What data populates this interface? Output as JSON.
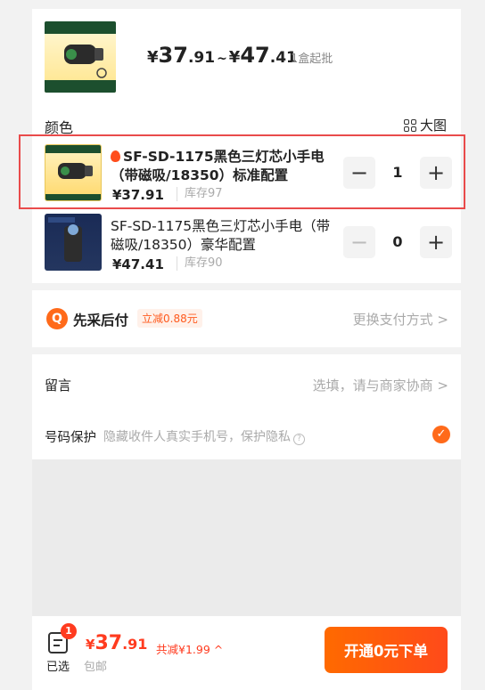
{
  "product": {
    "price_min_symbol": "¥",
    "price_min_int": "37",
    "price_min_dec": ".91",
    "price_sep": "~",
    "price_max_symbol": "¥",
    "price_max_int": "47",
    "price_max_dec": ".41",
    "min_order": "1盒起批"
  },
  "color_section": {
    "label": "颜色",
    "big_image_label": "大图"
  },
  "variants": [
    {
      "title": "SF-SD-1175黑色三灯芯小手电（带磁吸/18350）标准配置",
      "price": "¥37.91",
      "stock": "库存97",
      "quantity": "1",
      "minus": "−",
      "plus": "+"
    },
    {
      "title": "SF-SD-1175黑色三灯芯小手电（带磁吸/18350）豪华配置",
      "price": "¥47.41",
      "stock": "库存90",
      "quantity": "0",
      "minus": "−",
      "plus": "+"
    }
  ],
  "payment": {
    "icon_text": "Q",
    "title": "先采后付",
    "badge": "立减0.88元",
    "change": "更换支付方式 >"
  },
  "note": {
    "label": "留言",
    "hint": "选填，请与商家协商 >",
    "privacy_label": "号码保护",
    "privacy_desc": "隐藏收件人真实手机号，保护隐私",
    "help": "?",
    "check": "✓"
  },
  "bottom": {
    "badge": "1",
    "selected_label": "已选",
    "total_symbol": "¥",
    "total_int": "37",
    "total_dec": ".91",
    "discount": "共减¥1.99 ^",
    "shipping": "包邮",
    "order_button": "开通0元下单"
  },
  "colors": {
    "accent": "#ff5a1e",
    "highlight_border": "#e94b4b"
  }
}
